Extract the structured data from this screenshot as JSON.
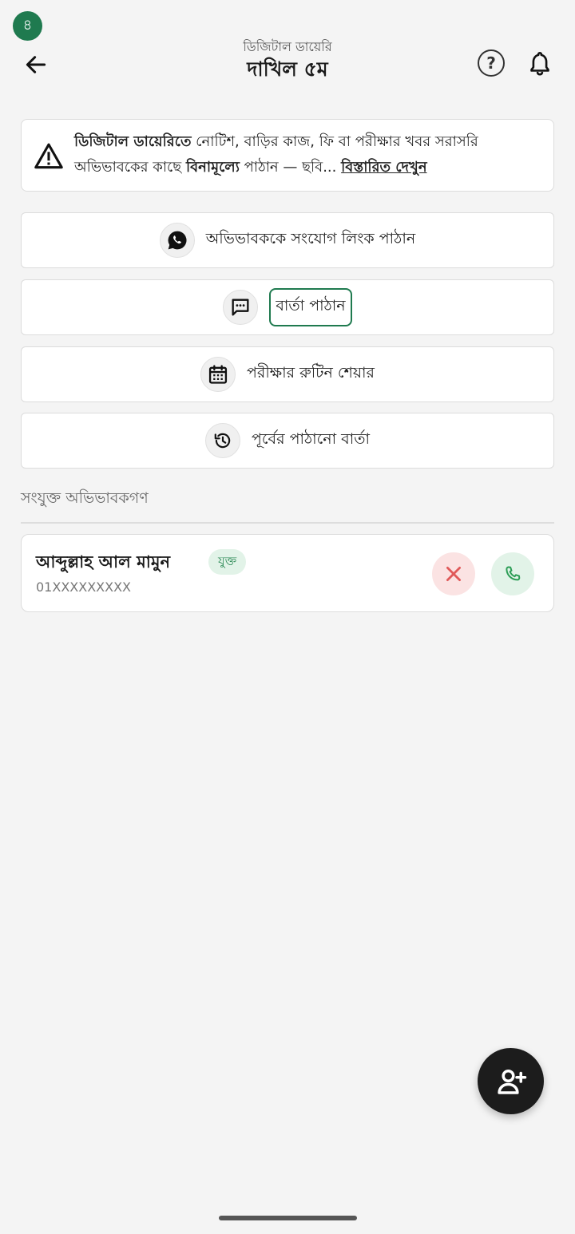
{
  "status_badge": "৪",
  "header": {
    "subtitle": "ডিজিটাল ডায়েরি",
    "title": "দাখিল ৫ম",
    "help": "?"
  },
  "notice": {
    "bold_lead": "ডিজিটাল ডায়েরিতে",
    "text_part1": " নোটিশ, বাড়ির কাজ, ফি বা পরীক্ষার খবর সরাসরি অভিভাবকের কাছে ",
    "bold_free": "বিনামূল্যে",
    "text_part2": " পাঠান — ছবি... ",
    "more_link": "বিস্তারিত দেখুন"
  },
  "actions": [
    {
      "label": "অভিভাবককে সংযোগ লিংক পাঠান",
      "icon": "whatsapp-icon"
    },
    {
      "label": "বার্তা পাঠান",
      "icon": "message-icon"
    },
    {
      "label": "পরীক্ষার রুটিন শেয়ার",
      "icon": "calendar-icon"
    },
    {
      "label": "পূর্বের পাঠানো বার্তা",
      "icon": "history-icon"
    }
  ],
  "parents_section": {
    "title": "সংযুক্ত অভিভাবকগণ",
    "items": [
      {
        "name": "আব্দুল্লাহ আল মামুন",
        "status": "যুক্ত",
        "phone": "01XXXXXXXXX"
      }
    ]
  },
  "colors": {
    "accent": "#1f7a4f",
    "background": "#f4f4f4",
    "remove": "#e05a5a",
    "call": "#2e9e57",
    "fab": "#1c1c1c"
  }
}
